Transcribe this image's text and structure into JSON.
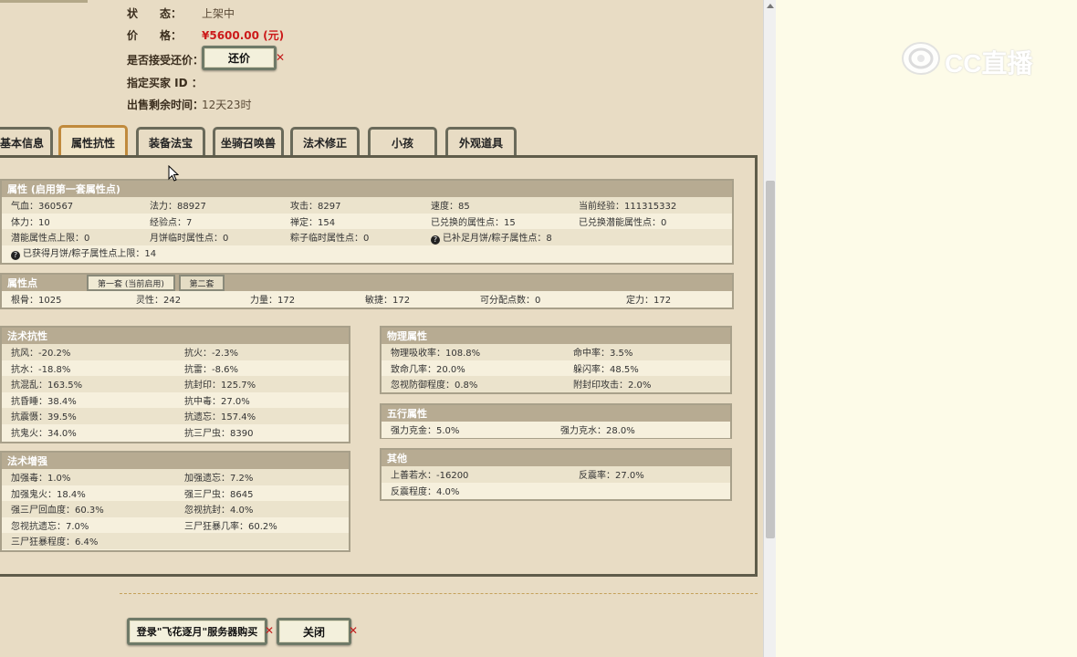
{
  "listing": {
    "status_label": "状　　态：",
    "status_value": "上架中",
    "price_label": "价　　格：",
    "price_value": "¥5600.00 (元)",
    "counter_label": "是否接受还价：",
    "counter_button": "还价",
    "buyer_label": "指定买家 ID ：",
    "remaining_label": "出售剩余时间：",
    "remaining_value": "12天23时"
  },
  "tabs": [
    "基本信息",
    "属性抗性",
    "装备法宝",
    "坐骑召唤兽",
    "法术修正",
    "小孩",
    "外观道具"
  ],
  "active_tab": "属性抗性",
  "attr": {
    "header": "属性 (启用第一套属性点)",
    "rows": [
      [
        "气血：360567",
        "法力：88927",
        "攻击：8297",
        "速度：85",
        "当前经验：111315332"
      ],
      [
        "体力：10",
        "经验点：7",
        "禅定：154",
        "已兑换的属性点：15",
        "已兑换潜能属性点：0"
      ],
      [
        "潜能属性点上限：0",
        "月饼临时属性点：0",
        "粽子临时属性点：0",
        "已补足月饼/粽子属性点：8",
        ""
      ],
      [
        "已获得月饼/粽子属性点上限：14",
        "",
        "",
        "",
        ""
      ]
    ]
  },
  "points": {
    "header": "属性点",
    "subtab1": "第一套 (当前启用)",
    "subtab2": "第二套",
    "row": [
      "根骨：1025",
      "灵性：242",
      "力量：172",
      "敏捷：172",
      "可分配点数：0",
      "定力：172"
    ]
  },
  "spell_res": {
    "header": "法术抗性",
    "rows": [
      [
        "抗风：-20.2%",
        "抗火：-2.3%"
      ],
      [
        "抗水：-18.8%",
        "抗雷：-8.6%"
      ],
      [
        "抗混乱：163.5%",
        "抗封印：125.7%"
      ],
      [
        "抗昏睡：38.4%",
        "抗中毒：27.0%"
      ],
      [
        "抗震慑：39.5%",
        "抗遗忘：157.4%"
      ],
      [
        "抗鬼火：34.0%",
        "抗三尸虫：8390"
      ]
    ]
  },
  "spell_boost": {
    "header": "法术增强",
    "rows": [
      [
        "加强毒：1.0%",
        "加强遗忘：7.2%"
      ],
      [
        "加强鬼火：18.4%",
        "强三尸虫：8645"
      ],
      [
        "强三尸回血度：60.3%",
        "忽视抗封：4.0%"
      ],
      [
        "忽视抗遗忘：7.0%",
        "三尸狂暴几率：60.2%"
      ],
      [
        "三尸狂暴程度：6.4%",
        ""
      ]
    ]
  },
  "physical": {
    "header": "物理属性",
    "rows": [
      [
        "物理吸收率：108.8%",
        "命中率：3.5%"
      ],
      [
        "致命几率：20.0%",
        "躲闪率：48.5%"
      ],
      [
        "忽视防御程度：0.8%",
        "附封印攻击：2.0%"
      ]
    ]
  },
  "elements": {
    "header": "五行属性",
    "rows": [
      [
        "强力克金：5.0%",
        "强力克水：28.0%"
      ]
    ]
  },
  "other": {
    "header": "其他",
    "rows": [
      [
        "上善若水：-16200",
        "反震率：27.0%"
      ],
      [
        "反震程度：4.0%",
        ""
      ]
    ]
  },
  "footer": {
    "buy_button": "登录\"飞花逐月\"服务器购买",
    "close_button": "关闭"
  },
  "watermark": "CC直播",
  "colors": {
    "background": "#e8dcc4",
    "price": "#cc1a1a",
    "section_header": "#b7ab92",
    "active_tab_border": "#c08a3c"
  }
}
